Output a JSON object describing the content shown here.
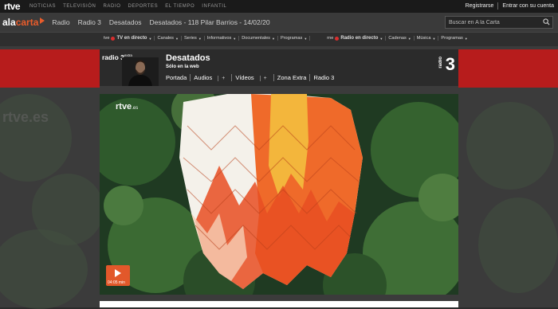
{
  "topbar": {
    "logo": "rtve",
    "nav": [
      "NOTICIAS",
      "TELEVISIÓN",
      "RADIO",
      "DEPORTES",
      "EL TIEMPO",
      "INFANTIL"
    ],
    "register": "Registrarse",
    "login": "Entrar con su cuenta"
  },
  "bar2": {
    "brand_a": "ala",
    "brand_b": "carta",
    "crumbs": [
      "Radio",
      "Radio 3",
      "Desatados",
      "Desatados - 118 Pilar Barrios - 14/02/20"
    ],
    "search_placeholder": "Buscar en A la Carta"
  },
  "bar3": {
    "tve_logo": "tve",
    "tv_directo": "TV en directo",
    "tv_items": [
      "Canales",
      "Series",
      "Informativos",
      "Documentales",
      "Programas"
    ],
    "rne_logo": "rne",
    "radio_directo": "Radio en directo",
    "radio_items": [
      "Cadenas",
      "Música",
      "Programas"
    ]
  },
  "header": {
    "logo_text": "radio 3",
    "logo_extra": "extra",
    "title": "Desatados",
    "subtitle": "Sólo en la web",
    "tabs": [
      "Portada",
      "Audios",
      "Vídeos",
      "Zona Extra",
      "Radio 3"
    ],
    "r3_number": "3",
    "r3_word": "radio"
  },
  "player": {
    "watermark": "rtve",
    "watermark_suffix": ".es",
    "duration": "04:05 min"
  },
  "background": {
    "watermark": "rtve.es"
  },
  "colors": {
    "accent": "#e95c2b",
    "red_stripe": "#b71c1c",
    "live_dot": "#d92e2e"
  }
}
